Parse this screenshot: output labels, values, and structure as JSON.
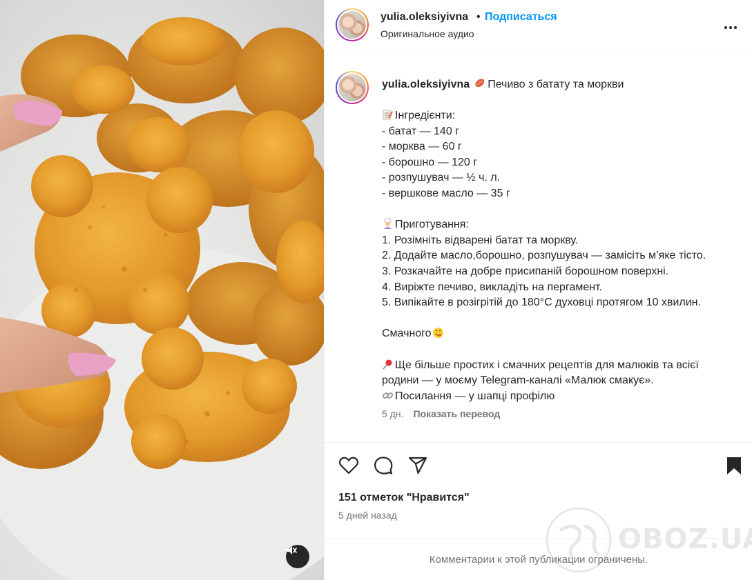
{
  "header": {
    "username": "yulia.oleksiyivna",
    "separator": "•",
    "follow_label": "Подписаться",
    "audio_label": "Оригинальное аудио",
    "more_icon": "more-horizontal-icon"
  },
  "caption": {
    "username": "yulia.oleksiyivna",
    "title": "Печиво з батату та моркви",
    "lines": {
      "ingredients_heading": "Інгредієнти:",
      "i1": "- батат — 140 г",
      "i2": "- морква — 60 г",
      "i3": "- борошно — 120 г",
      "i4": "- розпушувач — ½ ч. л.",
      "i5": "- вершкове масло — 35 г",
      "prep_heading": "Приготування:",
      "s1": "1. Розімніть відварені батат та моркву.",
      "s2": "2. Додайте масло,борошно, розпушувач — замісіть м’яке тісто.",
      "s3": "3. Розкачайте на добре присипаній борошном поверхні.",
      "s4": "4. Виріжте печиво, викладіть на пергамент.",
      "s5": "5. Випікайте в розігрітій до 180°C духовці протягом 10 хвилин.",
      "tasty": "Смачного",
      "promo1": "Ще більше простих і смачних рецептів для малюків та всієї",
      "promo2": "родини — у моєму Telegram-каналі «Малюк смакує».",
      "link_line": "Посилання — у шапці профілю"
    },
    "age": "5 дн.",
    "translate_label": "Показать перевод"
  },
  "actions": {
    "likes": "151 отметок \"Нравится\"",
    "date": "5 дней назад",
    "comments_closed": "Комментарии к этой публикации ограничены."
  },
  "watermark": {
    "text": "OBOZ.UA"
  },
  "colors": {
    "accent": "#0095f6",
    "text": "#262626",
    "secondary": "#737373",
    "cookie": "#e8a532"
  }
}
